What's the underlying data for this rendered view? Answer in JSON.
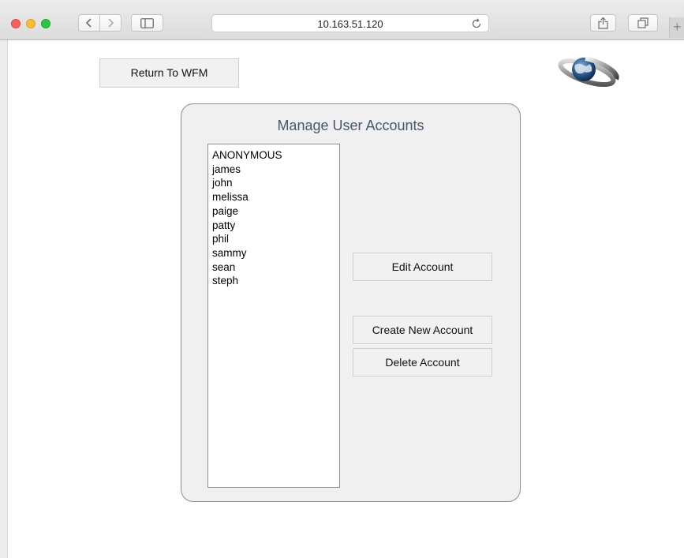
{
  "browser": {
    "address": "10.163.51.120",
    "new_tab_label": "+"
  },
  "header": {
    "return_label": "Return To WFM"
  },
  "panel": {
    "title": "Manage User Accounts",
    "users": [
      "ANONYMOUS",
      "james",
      "john",
      "melissa",
      "paige",
      "patty",
      "phil",
      "sammy",
      "sean",
      "steph"
    ],
    "edit_label": "Edit Account",
    "create_label": "Create New Account",
    "delete_label": "Delete Account"
  },
  "icons": {
    "logo": "globe-logo-icon",
    "reload": "reload-icon",
    "back": "chevron-left-icon",
    "forward": "chevron-right-icon",
    "sidebar": "sidebar-icon",
    "share": "share-icon",
    "tabs": "tabs-overview-icon"
  },
  "colors": {
    "panel_title": "#44586c",
    "panel_bg": "#f0f0f0",
    "button_bg": "#f1f1f1"
  }
}
